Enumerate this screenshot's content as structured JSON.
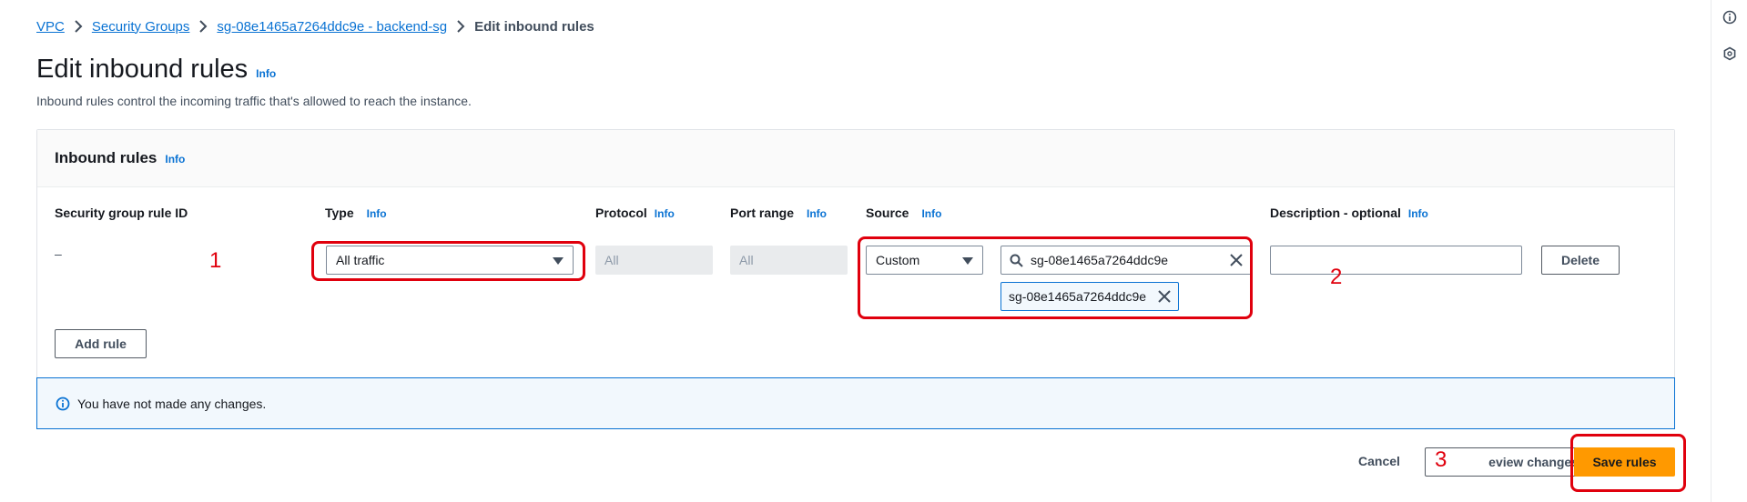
{
  "breadcrumb": {
    "items": [
      "VPC",
      "Security Groups",
      "sg-08e1465a7264ddc9e - backend-sg"
    ],
    "current": "Edit inbound rules"
  },
  "header": {
    "title": "Edit inbound rules",
    "info": "Info",
    "description": "Inbound rules control the incoming traffic that's allowed to reach the instance."
  },
  "panel": {
    "title": "Inbound rules",
    "info": "Info",
    "columns": {
      "rule_id": "Security group rule ID",
      "type": "Type",
      "protocol": "Protocol",
      "port_range": "Port range",
      "source": "Source",
      "description": "Description - optional",
      "info": "Info"
    },
    "row": {
      "rule_id": "–",
      "type": "All traffic",
      "protocol": "All",
      "port_range": "All",
      "source_type": "Custom",
      "source_search": "sg-08e1465a7264ddc9e",
      "source_token": "sg-08e1465a7264ddc9e",
      "description": "",
      "delete_label": "Delete"
    },
    "add_rule_label": "Add rule"
  },
  "alert": {
    "text": "You have not made any changes."
  },
  "footer": {
    "cancel_label": "Cancel",
    "preview_label": "eview changes",
    "save_label": "Save rules"
  },
  "annotations": [
    "1",
    "2",
    "3"
  ],
  "colors": {
    "link": "#0972d3",
    "primary": "#ff9900",
    "annotation": "#e0000d",
    "alert_bg": "#f2f8fd"
  },
  "icons": [
    "chevron-right-icon",
    "caret-down-icon",
    "search-icon",
    "close-icon",
    "info-circle-icon",
    "settings-hex-icon"
  ]
}
